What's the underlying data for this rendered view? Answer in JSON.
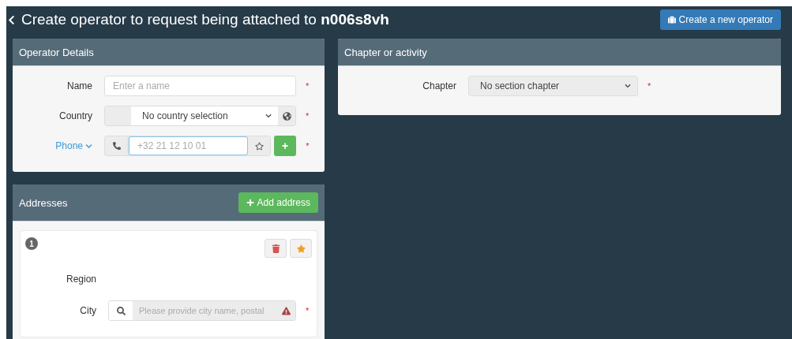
{
  "header": {
    "title": "Create operator to request being attached to ",
    "code": "n006s8vh",
    "button": "Create a new operator"
  },
  "operator": {
    "title": "Operator Details",
    "name": {
      "label": "Name",
      "placeholder": "Enter a name",
      "required": "*"
    },
    "country": {
      "label": "Country",
      "value": "No country selection",
      "required": "*"
    },
    "phone": {
      "label": "Phone",
      "placeholder": "+32 21 12 10 01",
      "required": "*",
      "add": "+"
    }
  },
  "addresses": {
    "title": "Addresses",
    "add_button": "Add address",
    "items": [
      {
        "number": "1",
        "region_label": "Region",
        "city_label": "City",
        "city_placeholder": "Please provide city name, postal",
        "required": "*"
      }
    ]
  },
  "chapter": {
    "title": "Chapter or activity",
    "label": "Chapter",
    "value": "No section chapter",
    "required": "*"
  }
}
